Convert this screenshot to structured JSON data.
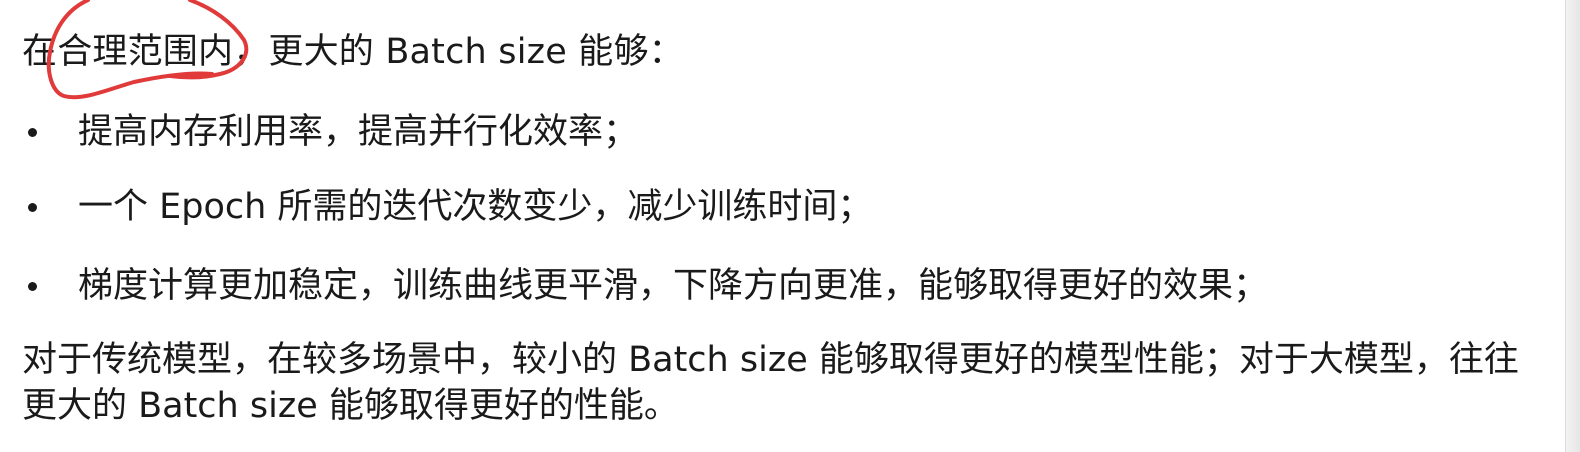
{
  "intro": {
    "text": "在合理范围内，更大的 Batch size 能够："
  },
  "bullets": [
    {
      "text": "提高内存利用率，提高并行化效率；"
    },
    {
      "text": "一个 Epoch 所需的迭代次数变少，减少训练时间；"
    },
    {
      "text": "梯度计算更加稳定，训练曲线更平滑，下降方向更准，能够取得更好的效果；"
    }
  ],
  "closing": {
    "text": "对于传统模型，在较多场景中，较小的 Batch size 能够取得更好的模型性能；对于大模型，往往更大的 Batch size 能够取得更好的性能。"
  },
  "annotation": {
    "color": "#e03a3a"
  }
}
